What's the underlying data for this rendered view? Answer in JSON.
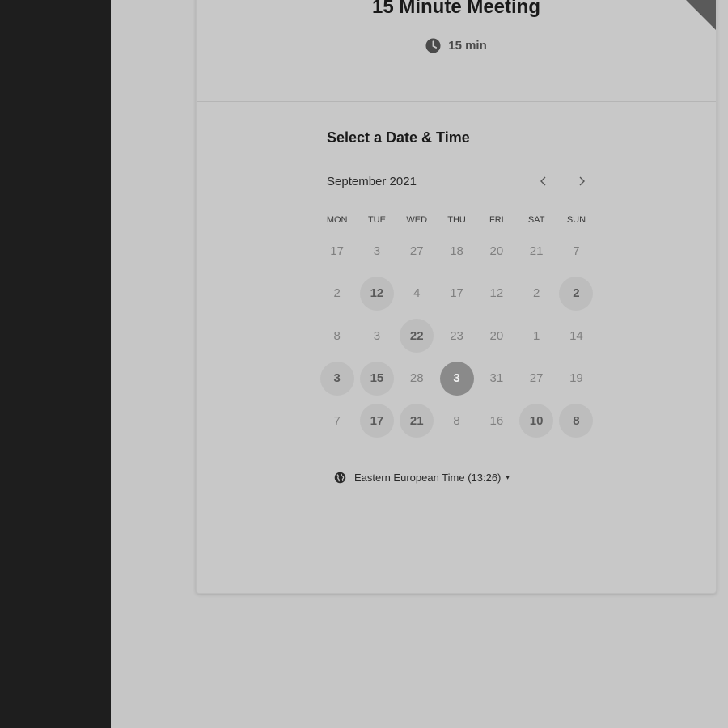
{
  "meeting": {
    "title": "15 Minute Meeting",
    "duration_icon": "clock-icon",
    "duration": "15 min"
  },
  "scheduler": {
    "title": "Select a Date & Time",
    "month": "September 2021",
    "prev_icon": "chevron-left-icon",
    "next_icon": "chevron-right-icon",
    "weekdays": [
      "MON",
      "TUE",
      "WED",
      "THU",
      "FRI",
      "SAT",
      "SUN"
    ],
    "weeks": [
      [
        {
          "d": "17",
          "s": "n"
        },
        {
          "d": "3",
          "s": "n"
        },
        {
          "d": "27",
          "s": "n"
        },
        {
          "d": "18",
          "s": "n"
        },
        {
          "d": "20",
          "s": "n"
        },
        {
          "d": "21",
          "s": "n"
        },
        {
          "d": "7",
          "s": "n"
        }
      ],
      [
        {
          "d": "2",
          "s": "n"
        },
        {
          "d": "12",
          "s": "a"
        },
        {
          "d": "4",
          "s": "n"
        },
        {
          "d": "17",
          "s": "n"
        },
        {
          "d": "12",
          "s": "n"
        },
        {
          "d": "2",
          "s": "n"
        },
        {
          "d": "2",
          "s": "a"
        }
      ],
      [
        {
          "d": "8",
          "s": "n"
        },
        {
          "d": "3",
          "s": "n"
        },
        {
          "d": "22",
          "s": "a"
        },
        {
          "d": "23",
          "s": "n"
        },
        {
          "d": "20",
          "s": "n"
        },
        {
          "d": "1",
          "s": "n"
        },
        {
          "d": "14",
          "s": "n"
        }
      ],
      [
        {
          "d": "3",
          "s": "a"
        },
        {
          "d": "15",
          "s": "a"
        },
        {
          "d": "28",
          "s": "n"
        },
        {
          "d": "3",
          "s": "sel"
        },
        {
          "d": "31",
          "s": "n"
        },
        {
          "d": "27",
          "s": "n"
        },
        {
          "d": "19",
          "s": "n"
        }
      ],
      [
        {
          "d": "7",
          "s": "n"
        },
        {
          "d": "17",
          "s": "a"
        },
        {
          "d": "21",
          "s": "a"
        },
        {
          "d": "8",
          "s": "n"
        },
        {
          "d": "16",
          "s": "n"
        },
        {
          "d": "10",
          "s": "a"
        },
        {
          "d": "8",
          "s": "a"
        }
      ]
    ],
    "timezone_icon": "globe-icon",
    "timezone": "Eastern European Time (13:26)",
    "timezone_caret": "▾"
  },
  "colors": {
    "background": "#c6c6c6",
    "sidebar": "#1e1e1e",
    "selected_day": "#8a8a8a",
    "available_day": "#bdbdbd"
  }
}
